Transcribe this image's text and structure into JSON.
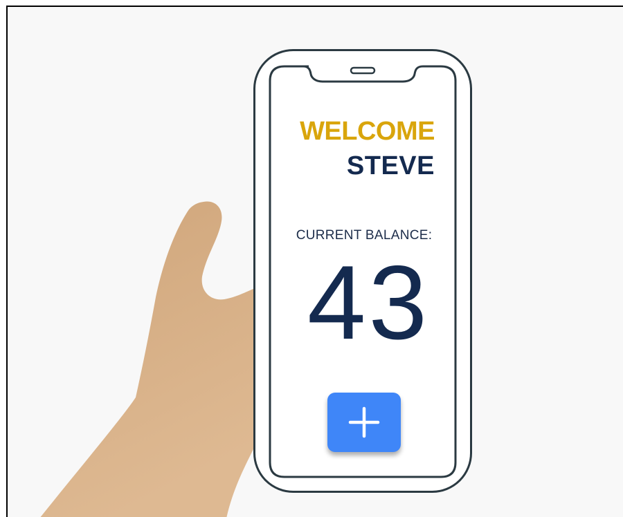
{
  "screen": {
    "welcome_text": "WELCOME",
    "user_name": "STEVE",
    "balance_label": "CURRENT BALANCE:",
    "balance_value": "43"
  },
  "add_button": {
    "icon": "plus-icon"
  },
  "colors": {
    "welcome": "#d9a50c",
    "name": "#142a4f",
    "balance_label": "#1c2c49",
    "balance_value": "#142a4f",
    "button": "#3f86f8",
    "button_icon": "#ffffff",
    "phone_outline": "#2b3a42",
    "phone_screen": "#ffffff",
    "skin": "#d8af82",
    "background": "#f8f8f8"
  }
}
